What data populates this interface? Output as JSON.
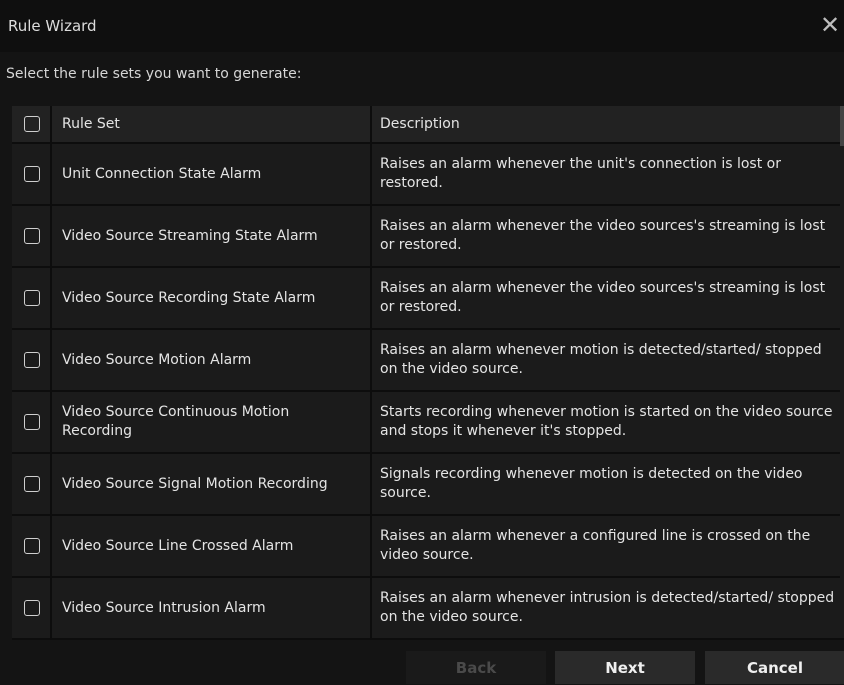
{
  "window": {
    "title": "Rule Wizard"
  },
  "prompt": "Select the rule sets you want to generate:",
  "table": {
    "headers": {
      "rule_set": "Rule Set",
      "description": "Description"
    },
    "rows": [
      {
        "name": "Unit Connection State Alarm",
        "description": "Raises an alarm whenever the unit's connection is lost or restored."
      },
      {
        "name": "Video Source Streaming State Alarm",
        "description": "Raises an alarm whenever the video sources's streaming is lost or restored."
      },
      {
        "name": "Video Source Recording State Alarm",
        "description": "Raises an alarm whenever the video sources's streaming is lost or restored."
      },
      {
        "name": "Video Source Motion Alarm",
        "description": "Raises an alarm whenever motion is detected/started/ stopped on the video source."
      },
      {
        "name": "Video Source Continuous Motion Recording",
        "description": "Starts recording whenever motion is started on the video source and stops it whenever it's stopped."
      },
      {
        "name": "Video Source Signal Motion Recording",
        "description": "Signals recording whenever motion is detected on the video source."
      },
      {
        "name": "Video Source Line Crossed Alarm",
        "description": "Raises an alarm whenever a configured line is crossed on the video source."
      },
      {
        "name": "Video Source Intrusion Alarm",
        "description": "Raises an alarm whenever intrusion is detected/started/ stopped on the video source."
      }
    ]
  },
  "buttons": {
    "back": "Back",
    "next": "Next",
    "cancel": "Cancel"
  },
  "icons": {
    "close": "close-icon",
    "checkbox": "checkbox-unchecked"
  }
}
